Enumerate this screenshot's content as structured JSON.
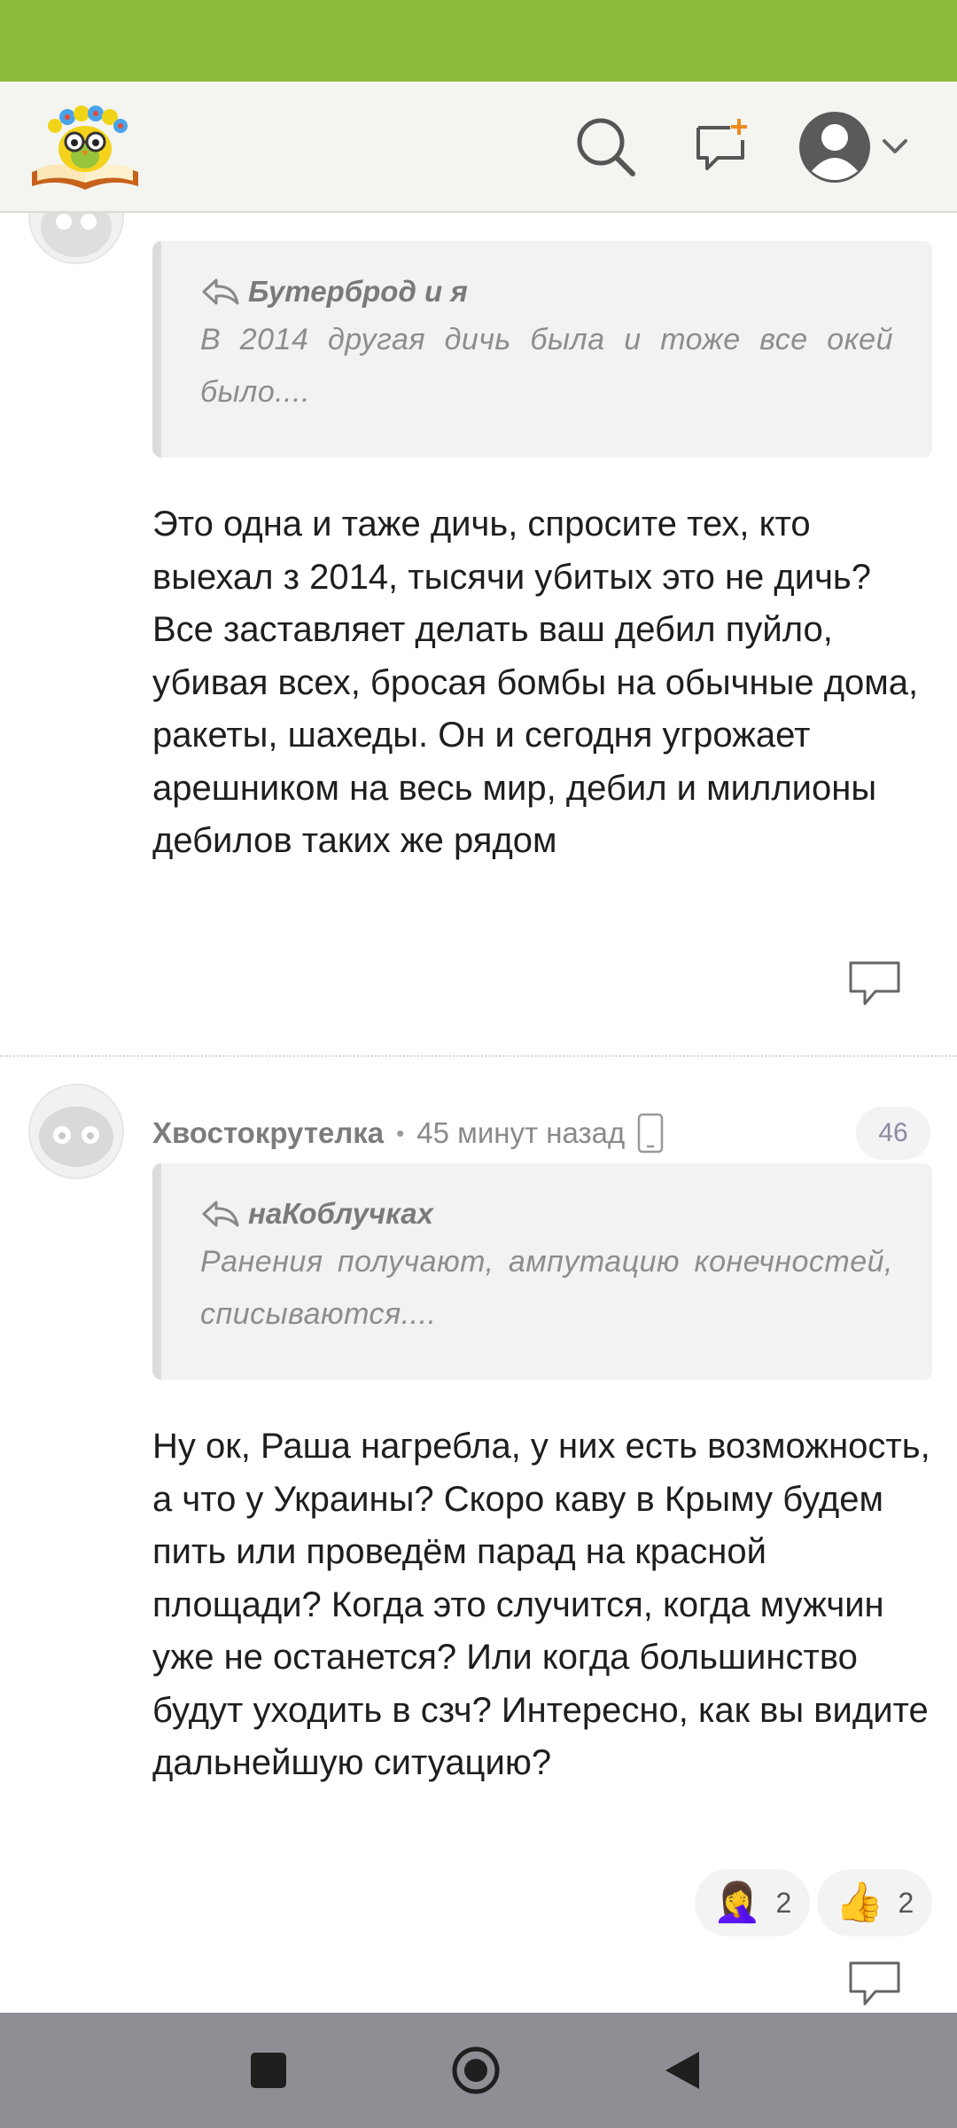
{
  "header": {
    "logo_icon": "owl-on-book-logo",
    "search_icon": "search-icon",
    "new_post_icon": "new-message-plus-icon",
    "profile_icon": "user-avatar-icon"
  },
  "comments": [
    {
      "quote": {
        "author": "Бутерброд и я",
        "text": "В 2014 другая дичь была и тоже все окей было...."
      },
      "body": "Это одна и таже дичь, спросите тех, кто выехал з 2014, тысячи убитых это не дичь? Все заставляет делать ваш дебил пуйло, убивая всех, бросая бомбы на обычные дома, ракеты, шахеды. Он и сегодня угрожает арешником на весь мир, дебил и миллионы дебилов таких же рядом"
    },
    {
      "author": "Хвостокрутелка",
      "time": "45 минут назад",
      "device_icon": "mobile-phone-icon",
      "number": "46",
      "quote": {
        "author": "наКоблучках",
        "text": "Ранения получают, ампутацию конечностей, списываются...."
      },
      "body": "Ну ок, Раша нагребла, у них есть возможность, а что у Украины? Скоро каву в Крыму будем пить или проведём парад на красной площади? Когда это случится, когда мужчин уже не останется? Или когда большинство будут уходить в сзч? Интересно, как вы видите дальнейшую ситуацию?",
      "reactions": [
        {
          "emoji": "🤦‍♀️",
          "count": "2"
        },
        {
          "emoji": "👍",
          "count": "2"
        }
      ]
    }
  ],
  "colors": {
    "status_bar": "#8cba3a",
    "app_bar": "#f4f4f1",
    "nav_bar": "#8e8e94"
  }
}
